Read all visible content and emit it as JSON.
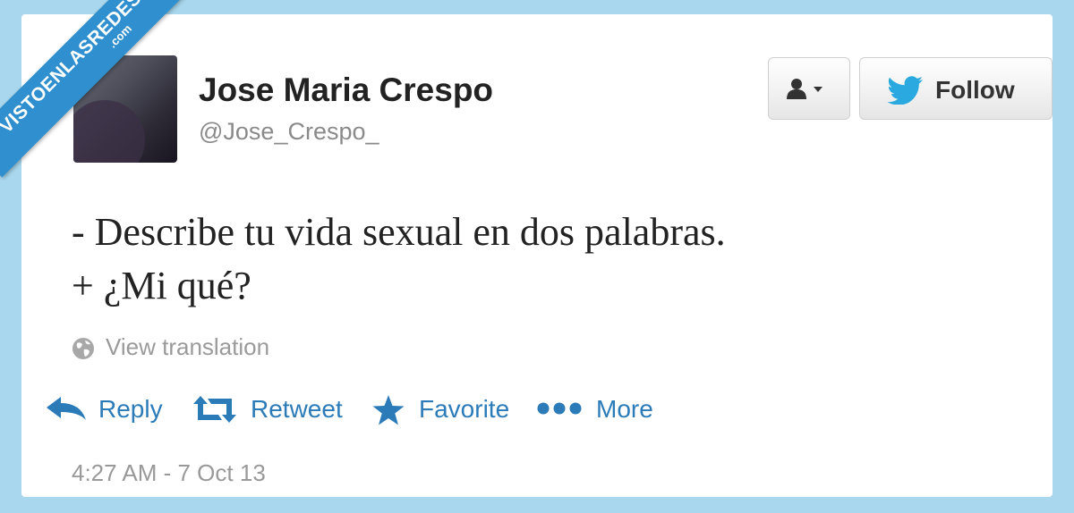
{
  "watermark": {
    "main": "VISTOENLASREDES",
    "sub": ".com"
  },
  "profile": {
    "name": "Jose Maria Crespo",
    "handle": "@Jose_Crespo_"
  },
  "buttons": {
    "follow_label": "Follow",
    "user_menu_icon": "user-dropdown-icon",
    "bird_icon": "twitter-bird-icon"
  },
  "tweet": {
    "line1": "- Describe tu vida sexual en dos palabras.",
    "line2": "+ ¿Mi qué?"
  },
  "translation": {
    "label": "View translation",
    "icon": "globe-icon"
  },
  "actions": {
    "reply": "Reply",
    "retweet": "Retweet",
    "favorite": "Favorite",
    "more": "More"
  },
  "timestamp": "4:27 AM - 7 Oct 13",
  "colors": {
    "background": "#a9d7ee",
    "accent": "#2b7bb9",
    "ribbon": "#2f8fcf"
  }
}
